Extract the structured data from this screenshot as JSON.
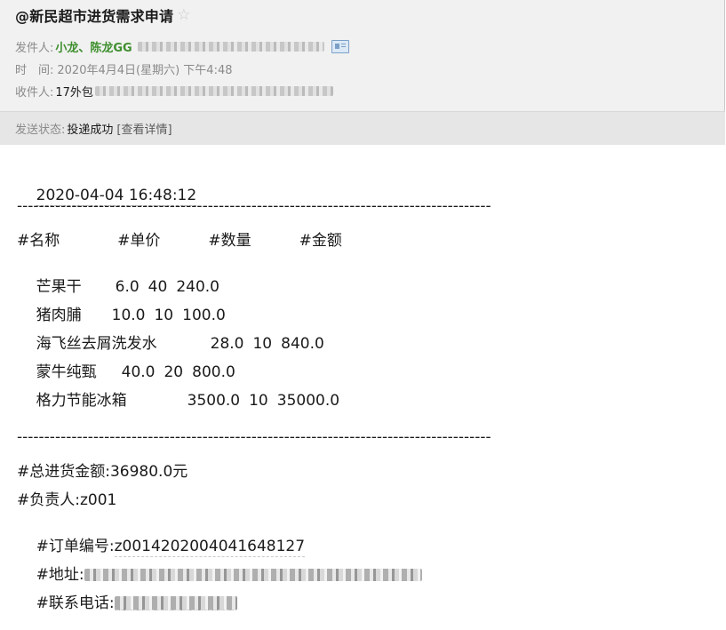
{
  "header": {
    "title": "@新民超市进货需求申请",
    "sender_label": "发件人:",
    "sender_names": "小龙、陈龙GG",
    "time_label": "时　间:",
    "time_value": "2020年4月4日(星期六) 下午4:48",
    "recipient_label": "收件人:",
    "recipient_value": "17外包",
    "status_label": "发送状态:",
    "status_value": "投递成功",
    "details_link": "[查看详情]"
  },
  "icons": {
    "star": "star-outline-icon",
    "card": "contact-card-icon"
  },
  "colors": {
    "sender_names": "#3f8f2e",
    "header_bg": "#f1f1f1",
    "status_bg": "#e6e6e6"
  },
  "body": {
    "timestamp": "2020-04-04 16:48:12",
    "separator": "---------------------------------------------------------------------------------------",
    "columns_header": "#名称            #单价          #数量          #金额",
    "items": [
      {
        "name": "芒果干",
        "unit_price": "6.0",
        "quantity": "40",
        "amount": "240.0"
      },
      {
        "name": "猪肉脯",
        "unit_price": "10.0",
        "quantity": "10",
        "amount": "100.0"
      },
      {
        "name": "海飞丝去屑洗发水",
        "unit_price": "28.0",
        "quantity": "10",
        "amount": "840.0"
      },
      {
        "name": "蒙牛纯甄",
        "unit_price": "40.0",
        "quantity": "20",
        "amount": "800.0"
      },
      {
        "name": "格力节能冰箱",
        "unit_price": "3500.0",
        "quantity": "10",
        "amount": "35000.0"
      }
    ],
    "total": "#总进货金额:36980.0元",
    "person_in_charge": "#负责人:z001",
    "order_number_label": "#订单编号:",
    "order_number_value": "z0014202004041648127",
    "address_label": "#地址:",
    "phone_label": "#联系电话:"
  }
}
